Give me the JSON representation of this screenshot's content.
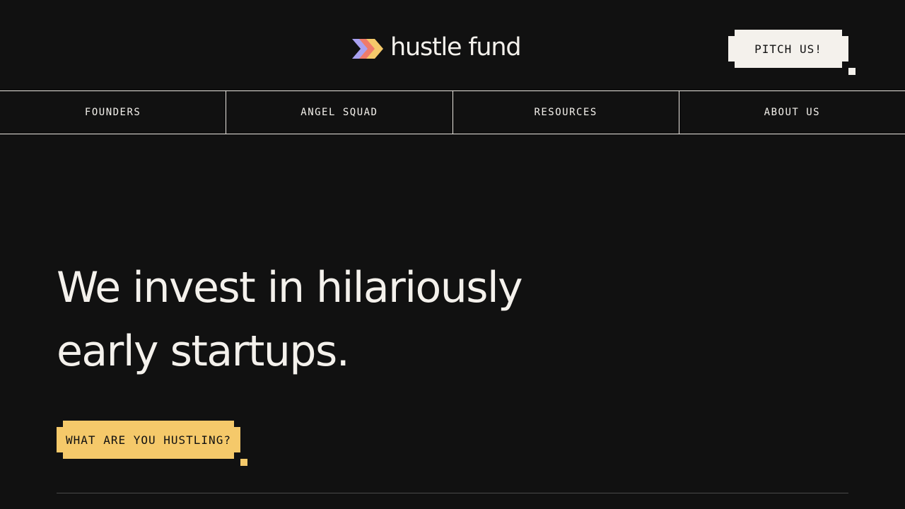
{
  "brand": {
    "name": "hustle fund",
    "logo_colors": [
      "#a9a1f0",
      "#ef7b6a",
      "#f5c96a"
    ]
  },
  "header": {
    "cta_label": "PITCH US!"
  },
  "nav": {
    "items": [
      {
        "label": "FOUNDERS"
      },
      {
        "label": "ANGEL SQUAD"
      },
      {
        "label": "RESOURCES"
      },
      {
        "label": "ABOUT US"
      }
    ]
  },
  "hero": {
    "title_line1": "We invest in hilariously",
    "title_line2": "early startups.",
    "cta_label": "WHAT ARE YOU HUSTLING?"
  },
  "colors": {
    "background": "#111111",
    "text": "#f4f1ec",
    "accent_yellow": "#f5c96a"
  }
}
